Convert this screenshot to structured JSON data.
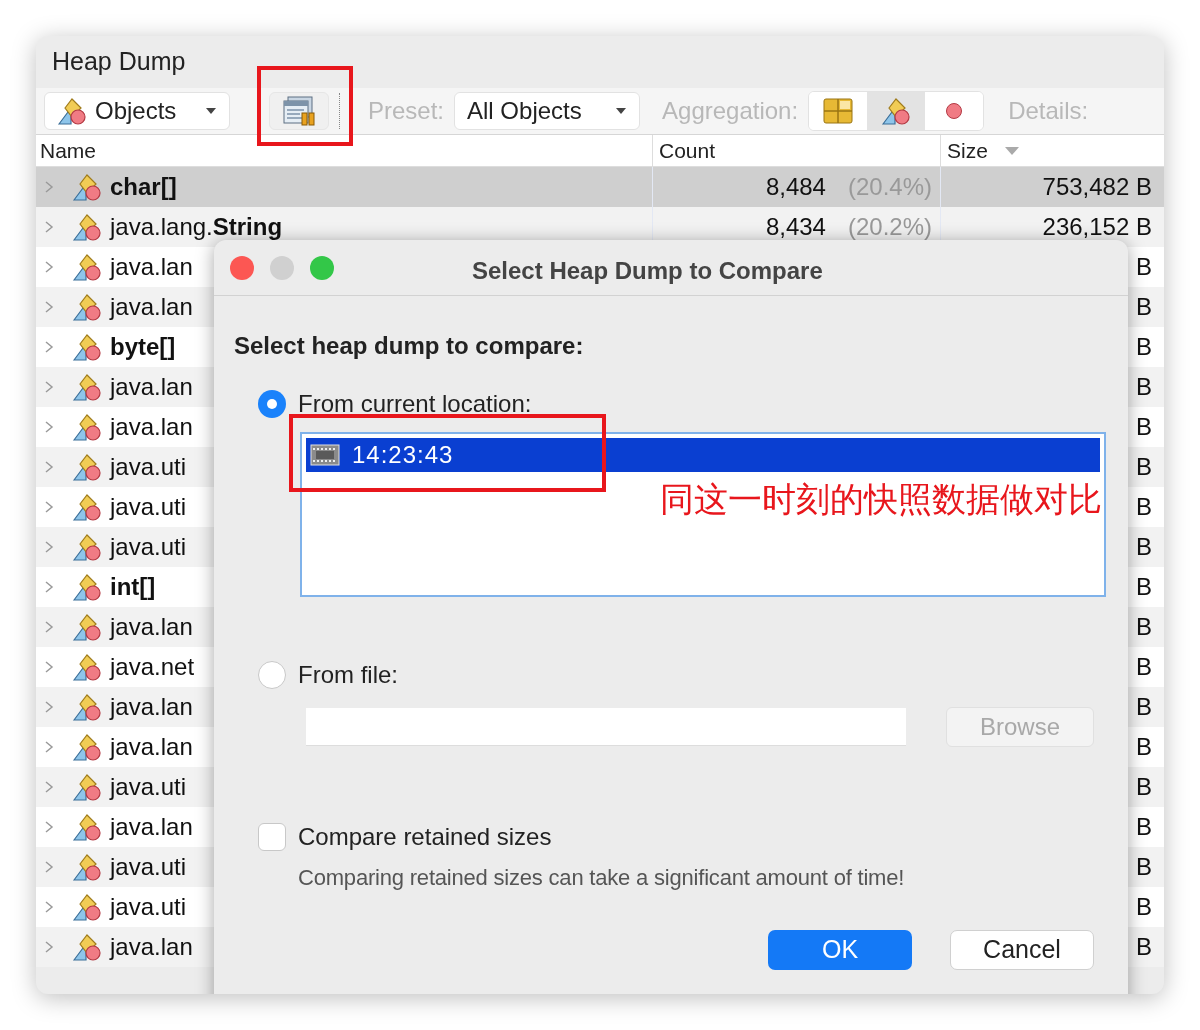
{
  "window": {
    "title": "Heap Dump"
  },
  "toolbar": {
    "view_dropdown": "Objects",
    "preset_label": "Preset:",
    "preset_dropdown": "All Objects",
    "aggregation_label": "Aggregation:",
    "aggregation_options": [
      {
        "kind": "packages",
        "selected": false
      },
      {
        "kind": "classes",
        "selected": true
      },
      {
        "kind": "instances",
        "selected": false
      }
    ],
    "details_label": "Details:"
  },
  "table": {
    "columns": [
      "Name",
      "Count",
      "Size"
    ],
    "rows": [
      {
        "name": "char[]",
        "bold": true,
        "selected": true,
        "count": "8,484",
        "percent": "(20.4%)",
        "size": "753,482 B"
      },
      {
        "name": "java.lang.**String**",
        "bold": false,
        "selected": false,
        "count": "8,434",
        "percent": "(20.2%)",
        "size": "236,152 B"
      },
      {
        "name": "java.lan",
        "bold": false,
        "selected": false,
        "size": "B"
      },
      {
        "name": "java.lan",
        "bold": false,
        "selected": false,
        "size": "B"
      },
      {
        "name": "byte[]",
        "bold": true,
        "selected": false,
        "size": "B"
      },
      {
        "name": "java.lan",
        "bold": false,
        "selected": false,
        "size": "B"
      },
      {
        "name": "java.lan",
        "bold": false,
        "selected": false,
        "size": "B"
      },
      {
        "name": "java.uti",
        "bold": false,
        "selected": false,
        "size": "B"
      },
      {
        "name": "java.uti",
        "bold": false,
        "selected": false,
        "size": "B"
      },
      {
        "name": "java.uti",
        "bold": false,
        "selected": false,
        "size": "B"
      },
      {
        "name": "int[]",
        "bold": true,
        "selected": false,
        "size": "B"
      },
      {
        "name": "java.lan",
        "bold": false,
        "selected": false,
        "size": "B"
      },
      {
        "name": "java.net",
        "bold": false,
        "selected": false,
        "size": "B"
      },
      {
        "name": "java.lan",
        "bold": false,
        "selected": false,
        "size": "B"
      },
      {
        "name": "java.lan",
        "bold": false,
        "selected": false,
        "size": "B"
      },
      {
        "name": "java.uti",
        "bold": false,
        "selected": false,
        "size": "B"
      },
      {
        "name": "java.lan",
        "bold": false,
        "selected": false,
        "size": "B"
      },
      {
        "name": "java.uti",
        "bold": false,
        "selected": false,
        "size": "B"
      },
      {
        "name": "java.uti",
        "bold": false,
        "selected": false,
        "size": "B"
      },
      {
        "name": "java.lan",
        "bold": false,
        "selected": false,
        "size": "B"
      }
    ]
  },
  "dialog": {
    "title": "Select Heap Dump to Compare",
    "heading": "Select heap dump to compare:",
    "options": [
      {
        "label": "From current location:",
        "selected": true
      },
      {
        "label": "From file:",
        "selected": false
      }
    ],
    "snapshots": [
      {
        "label": "14:23:43",
        "selected": true
      }
    ],
    "browse_button": "Browse",
    "retained": {
      "label": "Compare retained sizes",
      "checked": false,
      "note": "Comparing retained sizes can take a significant amount of time!"
    },
    "buttons": [
      {
        "label": "OK",
        "default": true
      },
      {
        "label": "Cancel",
        "default": false
      }
    ]
  },
  "annotation": {
    "text": "同这一时刻的快照数据做对比"
  }
}
